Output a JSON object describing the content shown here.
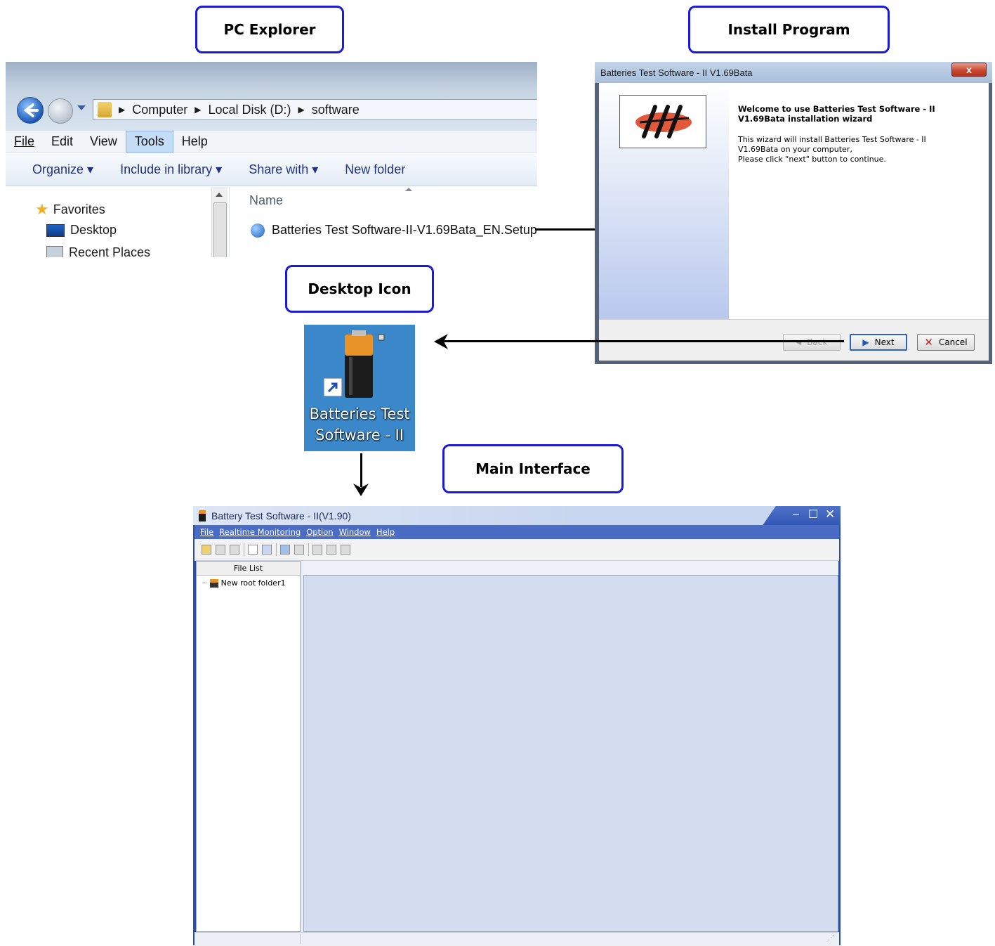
{
  "labels": {
    "pc_explorer": "PC Explorer",
    "install_program": "Install Program",
    "desktop_icon": "Desktop Icon",
    "main_interface": "Main Interface"
  },
  "explorer": {
    "breadcrumb": [
      "Computer",
      "Local Disk (D:)",
      "software"
    ],
    "menu": [
      "File",
      "Edit",
      "View",
      "Tools",
      "Help"
    ],
    "active_menu": "Tools",
    "commands": [
      "Organize ▾",
      "Include in library ▾",
      "Share with ▾",
      "New folder"
    ],
    "nav": {
      "favorites": "Favorites",
      "desktop": "Desktop",
      "recent": "Recent Places"
    },
    "column_header": "Name",
    "file": "Batteries Test Software-II-V1.69Bata_EN.Setup"
  },
  "wizard": {
    "title": "Batteries Test Software - II V1.69Bata",
    "close": "x",
    "heading": "Welcome to use Batteries Test Software - II V1.69Bata  installation wizard",
    "line1": "This wizard will install Batteries Test Software - II V1.69Bata on your computer,",
    "line2": "Please click \"next\" button to continue.",
    "back": "Back",
    "next": "Next",
    "cancel": "Cancel"
  },
  "desktop_icon": {
    "line1": "Batteries Test",
    "line2": "Software - II"
  },
  "main_window": {
    "title": "Battery Test Software - II(V1.90)",
    "menu": [
      "File",
      "Realtime Monitoring",
      "Option",
      "Window",
      "Help"
    ],
    "file_list_header": "File List",
    "tree_root": "New root folder1"
  },
  "colors": {
    "callout_border": "#1a1adb",
    "main_title": "#3358b5",
    "mdi_background": "#d4ddf0",
    "desktop_bg": "#3a88c9"
  }
}
